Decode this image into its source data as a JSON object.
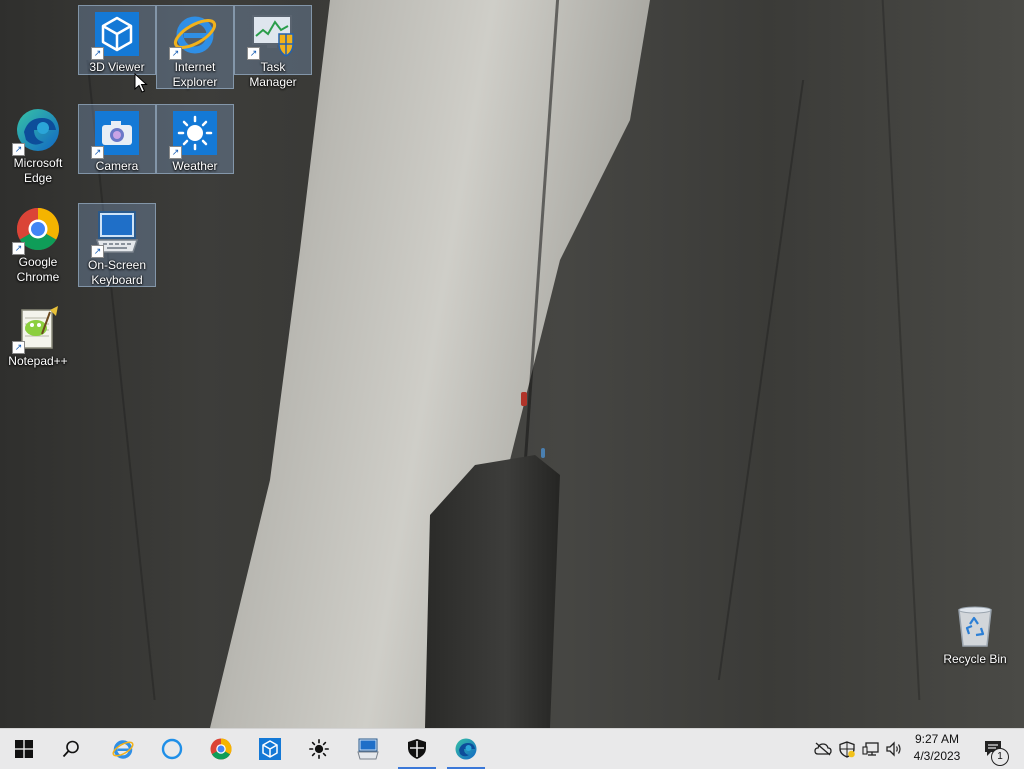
{
  "desktop": {
    "icons": [
      {
        "id": "3d-viewer",
        "label": "3D Viewer",
        "icon": "cube-icon"
      },
      {
        "id": "internet-explorer",
        "label": "Internet Explorer",
        "icon": "ie-icon"
      },
      {
        "id": "task-manager",
        "label": "Task Manager",
        "icon": "task-manager-icon"
      },
      {
        "id": "microsoft-edge",
        "label": "Microsoft Edge",
        "icon": "edge-icon"
      },
      {
        "id": "camera",
        "label": "Camera",
        "icon": "camera-icon"
      },
      {
        "id": "weather",
        "label": "Weather",
        "icon": "sun-icon"
      },
      {
        "id": "google-chrome",
        "label": "Google Chrome",
        "icon": "chrome-icon"
      },
      {
        "id": "on-screen-keyboard",
        "label": "On-Screen Keyboard",
        "icon": "keyboard-icon"
      },
      {
        "id": "notepad-plus-plus",
        "label": "Notepad++",
        "icon": "notepad-plus-plus-icon"
      },
      {
        "id": "recycle-bin",
        "label": "Recycle Bin",
        "icon": "recycle-bin-icon"
      }
    ]
  },
  "taskbar": {
    "pinned": [
      {
        "name": "start-button",
        "icon": "windows-logo-icon"
      },
      {
        "name": "search-button",
        "icon": "search-icon"
      },
      {
        "name": "internet-explorer",
        "icon": "ie-icon"
      },
      {
        "name": "cortana",
        "icon": "cortana-icon"
      },
      {
        "name": "google-chrome",
        "icon": "chrome-icon"
      },
      {
        "name": "3d-viewer",
        "icon": "cube-icon"
      },
      {
        "name": "weather",
        "icon": "sun-icon"
      },
      {
        "name": "on-screen-keyboard",
        "icon": "keyboard-icon"
      },
      {
        "name": "windows-security",
        "icon": "shield-icon",
        "running": true
      },
      {
        "name": "microsoft-edge",
        "icon": "edge-icon",
        "running": true
      }
    ],
    "tray": [
      "onedrive-offline-icon",
      "security-warning-icon",
      "network-icon",
      "volume-icon"
    ],
    "clock": {
      "time": "9:27 AM",
      "date": "4/3/2023"
    },
    "notifications": {
      "count": "1",
      "icon": "notifications-icon"
    }
  },
  "colors": {
    "taskbar": "#e9e9ea",
    "accent": "#3b78d8",
    "selection": "#82a0c8"
  }
}
